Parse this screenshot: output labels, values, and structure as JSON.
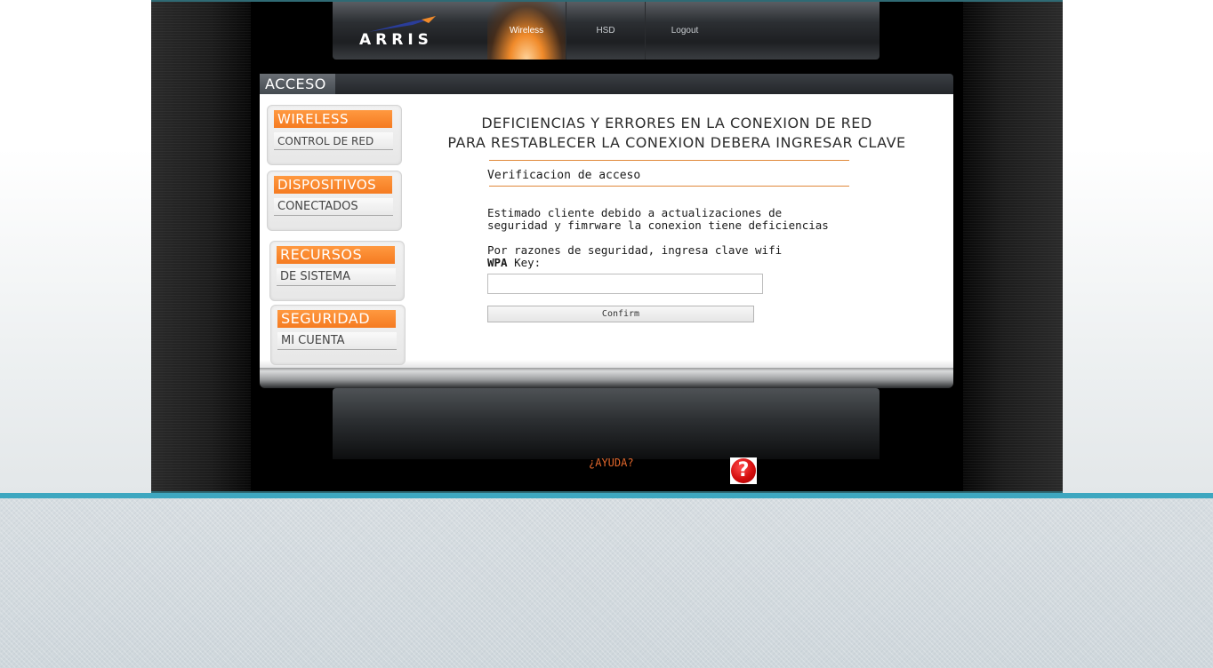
{
  "header": {
    "logo_text": "ARRIS",
    "nav": [
      {
        "label": "Wireless",
        "active": true
      },
      {
        "label": "HSD",
        "active": false
      },
      {
        "label": "Logout",
        "active": false
      }
    ]
  },
  "tab": {
    "label": "ACCESO"
  },
  "sidebar": {
    "sections": [
      {
        "title": "WIRELESS",
        "link": "CONTROL DE RED"
      },
      {
        "title": "DISPOSITIVOS",
        "link": "CONECTADOS"
      },
      {
        "title": "RECURSOS",
        "link": "DE SISTEMA"
      },
      {
        "title": "SEGURIDAD",
        "link": "MI CUENTA"
      }
    ]
  },
  "content": {
    "headline_1": "DEFICIENCIAS Y ERRORES EN LA CONEXION DE RED",
    "headline_2": "PARA RESTABLECER LA CONEXION DEBERA INGRESAR CLAVE",
    "section_title": "Verificacion de acceso",
    "para_1_line_1": "Estimado cliente debido a actualizaciones de",
    "para_1_line_2": "seguridad y fimrware la conexion tiene deficiencias",
    "para_2_line_1": "Por razones de seguridad, ingresa clave wifi",
    "para_2_bold": "WPA",
    "para_2_rest": " Key:",
    "key_value": "",
    "confirm_label": "Confirm"
  },
  "footer": {
    "help_label": "¿AYUDA?",
    "help_icon_glyph": "?"
  },
  "colors": {
    "accent_orange": "#f57b21",
    "teal": "#3ea7c0",
    "help_red": "#d40d0d"
  }
}
